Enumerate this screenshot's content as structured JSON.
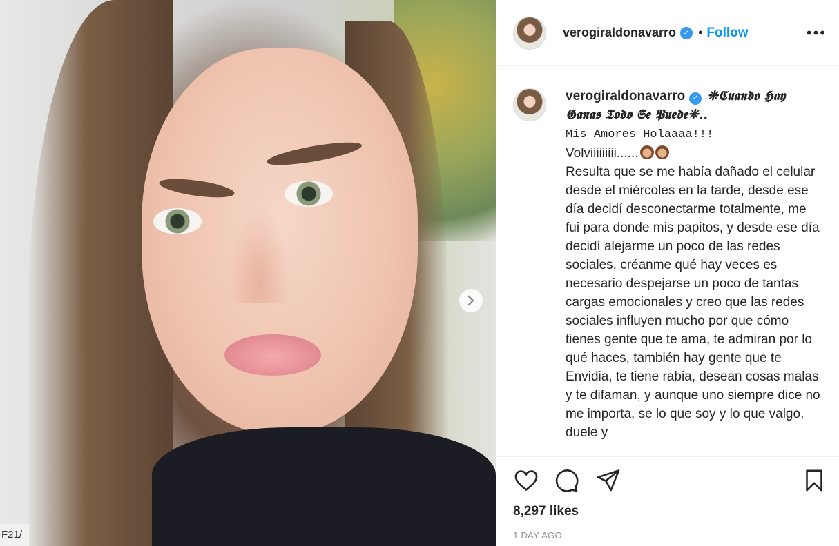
{
  "photo": {
    "carousel_next_icon": "chevron-right-icon",
    "corner_label": "F21/"
  },
  "header": {
    "username": "verogiraldonavarro",
    "separator": "•",
    "follow_label": "Follow",
    "more_label": "•••"
  },
  "caption": {
    "username": "verogiraldonavarro",
    "fancy_line": "❈𝕮𝖚𝖆𝖓𝖉𝖔 𝕳𝖆𝖞 𝕲𝖆𝖓𝖆𝖘 𝕿𝖔𝖉𝖔 𝕾𝖊 𝕻𝖚𝖊𝖉𝖊❈..",
    "greeting": "Mis Amores Holaaaa!!!",
    "back": "Volviiiiiiiii......",
    "body": "Resulta que se me había dañado el celular desde el miércoles en la tarde, desde ese día decidí desconectarme totalmente, me fui para donde mis papitos, y desde ese día decidí alejarme un poco de las redes sociales, créanme qué hay veces es necesario despejarse un poco de tantas cargas emocionales y creo que las redes sociales influyen mucho por que cómo tienes gente que te ama, te admiran por lo qué haces, también hay gente que te Envidia, te tiene rabia, desean cosas malas y te difaman, y aunque uno siempre dice no me importa, se lo que soy y lo que valgo, duele y"
  },
  "actions": {
    "like_icon": "heart-icon",
    "comment_icon": "comment-icon",
    "share_icon": "paper-plane-icon",
    "save_icon": "bookmark-icon"
  },
  "likes": "8,297 likes",
  "timestamp": "1 DAY AGO",
  "colors": {
    "link": "#0095f6",
    "verified": "#3897f0",
    "muted": "#8e8e8e"
  }
}
